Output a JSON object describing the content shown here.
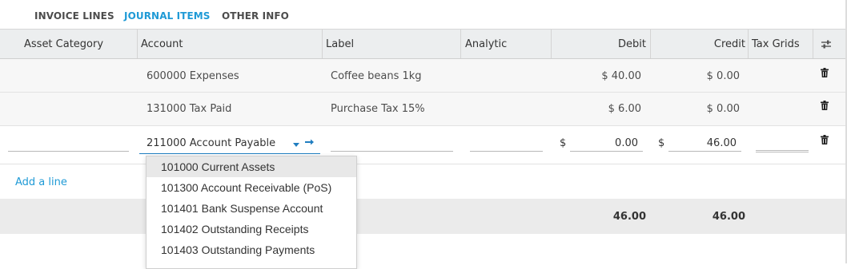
{
  "tabs": [
    {
      "label": "INVOICE LINES"
    },
    {
      "label": "JOURNAL ITEMS",
      "active": true
    },
    {
      "label": "OTHER INFO"
    }
  ],
  "columns": {
    "asset_category": "Asset Category",
    "account": "Account",
    "label": "Label",
    "analytic": "Analytic",
    "debit": "Debit",
    "credit": "Credit",
    "tax_grids": "Tax Grids"
  },
  "rows": [
    {
      "account": "600000 Expenses",
      "label": "Coffee beans 1kg",
      "debit": "$ 40.00",
      "credit": "$ 0.00"
    },
    {
      "account": "131000 Tax Paid",
      "label": "Purchase Tax 15%",
      "debit": "$ 6.00",
      "credit": "$ 0.00"
    }
  ],
  "edit_row": {
    "account": "211000 Account Payable",
    "currency": "$",
    "debit": "0.00",
    "credit": "46.00"
  },
  "add_line": "Add a line",
  "totals": {
    "debit": "46.00",
    "credit": "46.00"
  },
  "dropdown": {
    "items": [
      "101000 Current Assets",
      "101300 Account Receivable (PoS)",
      "101401 Bank Suspense Account",
      "101402 Outstanding Receipts",
      "101403 Outstanding Payments"
    ]
  },
  "colors": {
    "accent": "#1f9ad6",
    "header_bg": "#eceeef",
    "footer_bg": "#ebebeb"
  },
  "icons": [
    "trash-icon",
    "column-settings-icon",
    "caret-down-icon",
    "external-link-arrow-icon"
  ]
}
